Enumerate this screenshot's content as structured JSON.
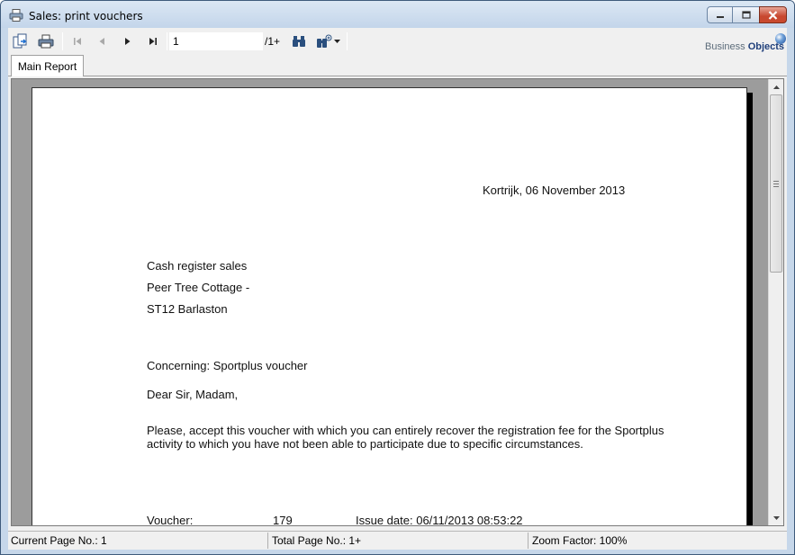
{
  "window": {
    "title": "Sales: print vouchers"
  },
  "toolbar": {
    "page_input_value": "1",
    "page_total": "/1+",
    "logo_text_light": "Business",
    "logo_text_bold": "Objects"
  },
  "tabs": [
    {
      "label": "Main Report"
    }
  ],
  "report": {
    "date_line": "Kortrijk,  06 November 2013",
    "address": [
      "Cash register sales",
      "Peer Tree Cottage  -",
      "ST12 Barlaston"
    ],
    "concerning": "Concerning: Sportplus voucher",
    "salutation": "Dear Sir, Madam,",
    "body": "Please, accept this voucher with which you can entirely recover the registration fee for the Sportplus activity to which you have not been able to participate due to specific circumstances.",
    "voucher_label": "Voucher:",
    "voucher_number": "179",
    "issue_date": "Issue date: 06/11/2013  08:53:22"
  },
  "statusbar": {
    "current_page": "Current Page No.: 1",
    "total_page": "Total Page No.: 1+",
    "zoom": "Zoom Factor: 100%"
  }
}
